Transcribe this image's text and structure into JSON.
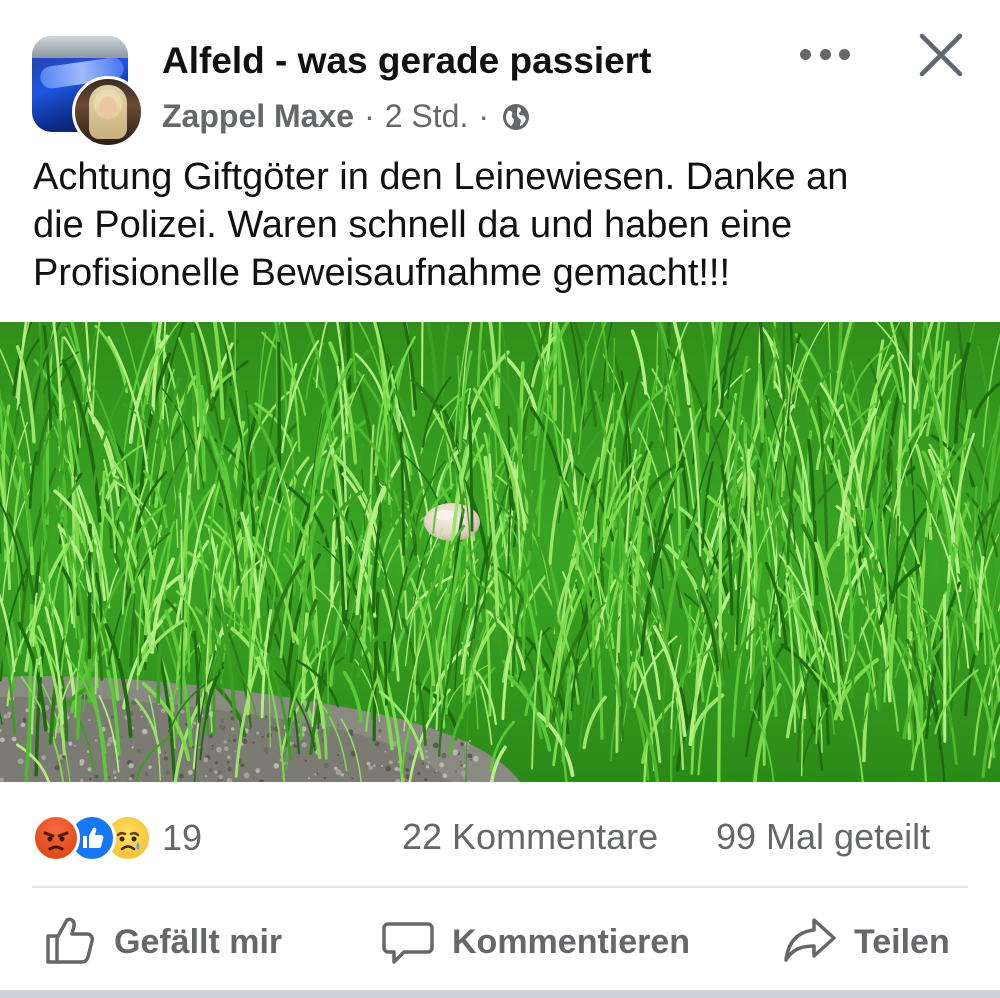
{
  "post": {
    "group_name": "Alfeld - was gerade passiert",
    "author": "Zappel Maxe",
    "separator": "·",
    "time": "2 Std.",
    "privacy_icon": "globe-icon",
    "text_lines": [
      "Achtung Giftgöter in den Leinewiesen. Danke an",
      "die Polizei. Waren schnell da und haben eine",
      "Profisionelle Beweisaufnahme gemacht!!!"
    ]
  },
  "header_controls": {
    "more_icon": "more-horizontal-icon",
    "close_icon": "close-icon"
  },
  "stats": {
    "reactions": [
      "angry",
      "like",
      "sad"
    ],
    "reaction_count": "19",
    "comments": "22 Kommentare",
    "shares": "99 Mal geteilt"
  },
  "actions": {
    "like": "Gefällt mir",
    "comment": "Kommentieren",
    "share": "Teilen"
  },
  "colors": {
    "like_blue": "#1877f2",
    "meta_gray": "#65676b",
    "grass_green": "#3fae26"
  }
}
